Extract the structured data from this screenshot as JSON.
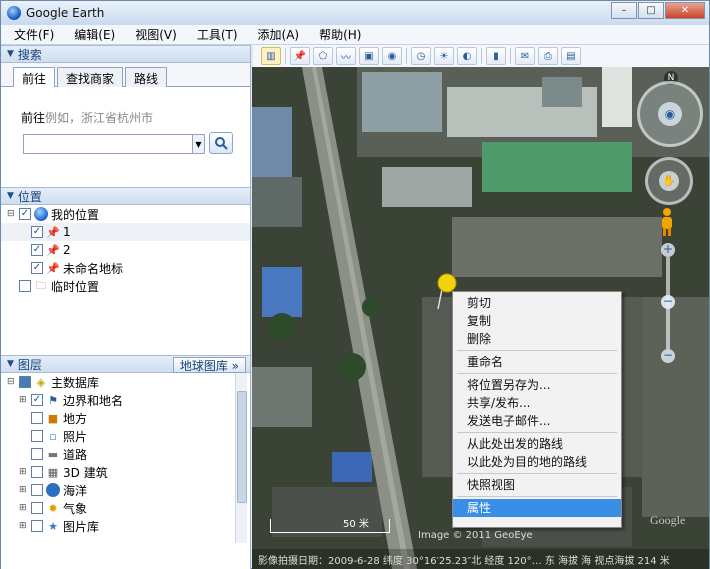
{
  "window": {
    "title": "Google Earth",
    "minimize": "–",
    "maximize": "□",
    "close": "✕"
  },
  "menubar": [
    "文件(F)",
    "编辑(E)",
    "视图(V)",
    "工具(T)",
    "添加(A)",
    "帮助(H)"
  ],
  "search": {
    "header": "搜索",
    "tabs": [
      "前往",
      "查找商家",
      "路线"
    ],
    "goto_label": "前往",
    "goto_hint": "例如，浙江省杭州市",
    "input_value": ""
  },
  "places": {
    "header": "位置",
    "root": "我的位置",
    "items": [
      "1",
      "2",
      "未命名地标"
    ],
    "temp": "临时位置"
  },
  "layers": {
    "header": "图层",
    "gallery_button": "地球图库 »",
    "root": "主数据库",
    "items": [
      "边界和地名",
      "地方",
      "照片",
      "道路",
      "3D 建筑",
      "海洋",
      "气象",
      "图片库"
    ]
  },
  "context_menu": {
    "groups": [
      [
        "剪切",
        "复制",
        "删除"
      ],
      [
        "重命名"
      ],
      [
        "将位置另存为...",
        "共享/发布...",
        "发送电子邮件..."
      ],
      [
        "从此处出发的路线",
        "以此处为目的地的路线"
      ],
      [
        "快照视图"
      ],
      [
        "属性"
      ]
    ],
    "active_item": "属性"
  },
  "map": {
    "scale_label": "50 米",
    "image_credit": "Image © 2011 GeoEye",
    "status": "影像拍摄日期：2009-6-28   纬度 30°16′25.23″北   经度 120°…   东 海拔  海 视点海拔   214 米",
    "watermark": "Google"
  }
}
